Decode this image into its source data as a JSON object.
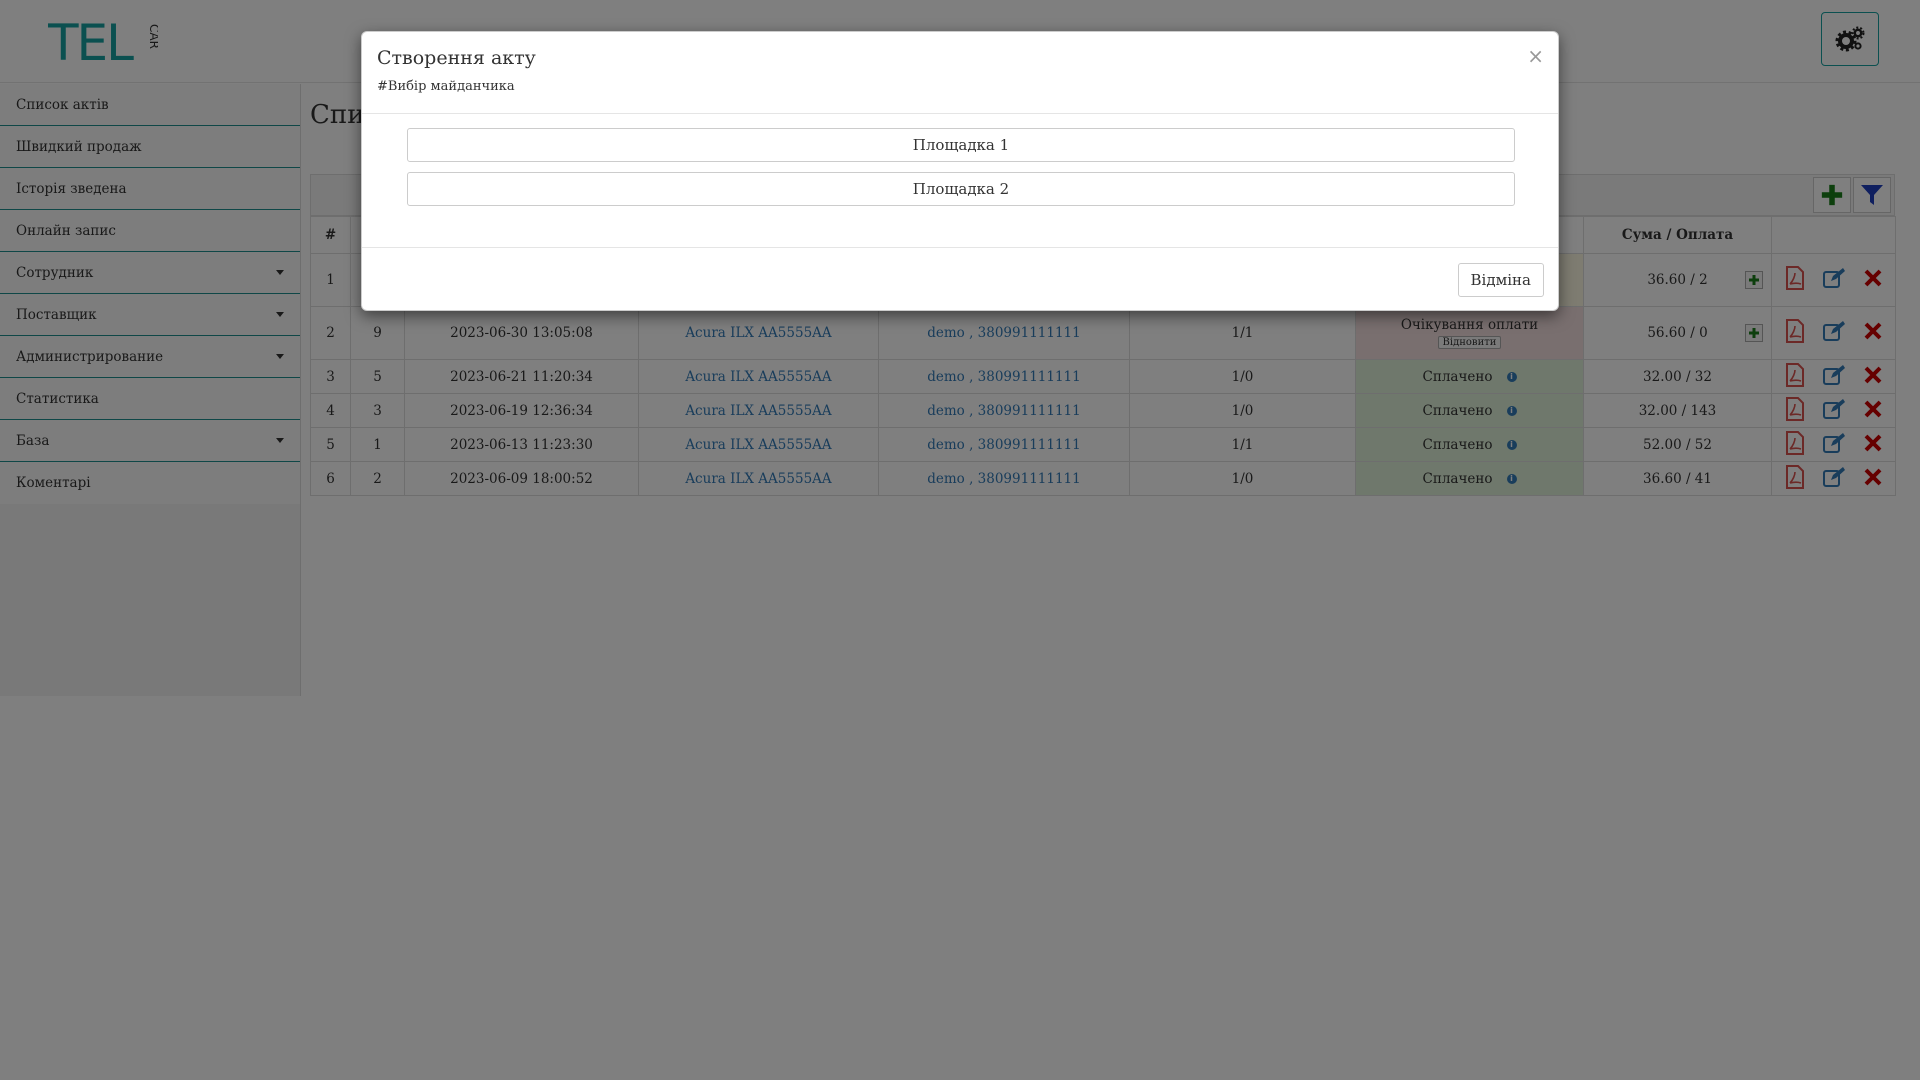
{
  "header": {
    "logo_text": "TEL",
    "logo_subtext": "CAR",
    "settings_icon": "gears-icon"
  },
  "sidebar": {
    "items": [
      {
        "label": "Список актів",
        "has_dropdown": false
      },
      {
        "label": "Швидкий продаж",
        "has_dropdown": false
      },
      {
        "label": "Історія зведена",
        "has_dropdown": false
      },
      {
        "label": "Онлайн запис",
        "has_dropdown": false
      },
      {
        "label": "Сотрудник",
        "has_dropdown": true
      },
      {
        "label": "Поставщик",
        "has_dropdown": true
      },
      {
        "label": "Администрирование",
        "has_dropdown": true
      },
      {
        "label": "Статистика",
        "has_dropdown": false
      },
      {
        "label": "База",
        "has_dropdown": true
      },
      {
        "label": "Коментарі",
        "has_dropdown": false
      }
    ]
  },
  "main": {
    "title": "Спи",
    "table": {
      "headers": {
        "index": "#",
        "sum": "Сума / Оплата"
      },
      "rows": [
        {
          "n": "1",
          "id": "",
          "date": "",
          "car": "",
          "client": "",
          "count": "",
          "status": "",
          "status_type": "wait-top",
          "sum": "36.60 / 2",
          "has_plus": true
        },
        {
          "n": "2",
          "id": "9",
          "date": "2023-06-30 13:05:08",
          "car": "Acura ILX AA5555AA",
          "client": "demo , 380991111111",
          "count": "1/1",
          "status": "Очікування оплати",
          "status_type": "wait",
          "restore": "Відновити",
          "sum": "56.60 / 0",
          "has_plus": true
        },
        {
          "n": "3",
          "id": "5",
          "date": "2023-06-21 11:20:34",
          "car": "Acura ILX AA5555AA",
          "client": "demo , 380991111111",
          "count": "1/0",
          "status": "Сплачено",
          "status_type": "paid",
          "sum": "32.00 / 32",
          "has_plus": false
        },
        {
          "n": "4",
          "id": "3",
          "date": "2023-06-19 12:36:34",
          "car": "Acura ILX AA5555AA",
          "client": "demo , 380991111111",
          "count": "1/0",
          "status": "Сплачено",
          "status_type": "paid",
          "sum": "32.00 / 143",
          "has_plus": false
        },
        {
          "n": "5",
          "id": "1",
          "date": "2023-06-13 11:23:30",
          "car": "Acura ILX AA5555AA",
          "client": "demo , 380991111111",
          "count": "1/1",
          "status": "Сплачено",
          "status_type": "paid",
          "sum": "52.00 / 52",
          "has_plus": false
        },
        {
          "n": "6",
          "id": "2",
          "date": "2023-06-09 18:00:52",
          "car": "Acura ILX AA5555AA",
          "client": "demo , 380991111111",
          "count": "1/0",
          "status": "Сплачено",
          "status_type": "paid",
          "sum": "36.60 / 41",
          "has_plus": false
        }
      ]
    }
  },
  "modal": {
    "title": "Створення акту",
    "subtitle": "#Вибір майданчика",
    "close_label": "×",
    "options": [
      "Площадка 1",
      "Площадка 2"
    ],
    "cancel_label": "Відміна"
  },
  "colors": {
    "accent": "#16a0a0",
    "link": "#337ab7",
    "paid_bg": "#dff0d8",
    "wait_bg": "#f2dede",
    "pdf": "#d9534f",
    "edit": "#337ab7",
    "delete": "#cc0000",
    "add": "#1a7f1a",
    "filter": "#1f3fbf"
  }
}
